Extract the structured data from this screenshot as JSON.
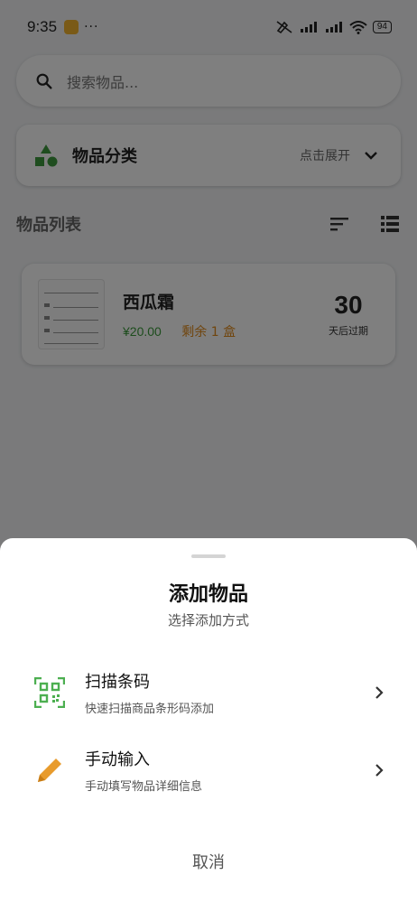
{
  "status_bar": {
    "time": "9:35",
    "dots": "···",
    "battery": "94"
  },
  "search": {
    "placeholder": "搜索物品..."
  },
  "category": {
    "title": "物品分类",
    "hint": "点击展开"
  },
  "list": {
    "title": "物品列表",
    "items": [
      {
        "name": "西瓜霜",
        "price": "¥20.00",
        "remaining": "剩余 1 盒",
        "days": "30",
        "days_label": "天后过期"
      }
    ]
  },
  "sheet": {
    "title": "添加物品",
    "subtitle": "选择添加方式",
    "options": [
      {
        "title": "扫描条码",
        "desc": "快速扫描商品条形码添加",
        "icon": "qr-scan-icon"
      },
      {
        "title": "手动输入",
        "desc": "手动填写物品详细信息",
        "icon": "pencil-icon"
      }
    ],
    "cancel": "取消"
  },
  "colors": {
    "accent_green": "#3a9a3a",
    "accent_orange": "#e89b2c",
    "overlay": "rgba(0,0,0,0.5)"
  }
}
